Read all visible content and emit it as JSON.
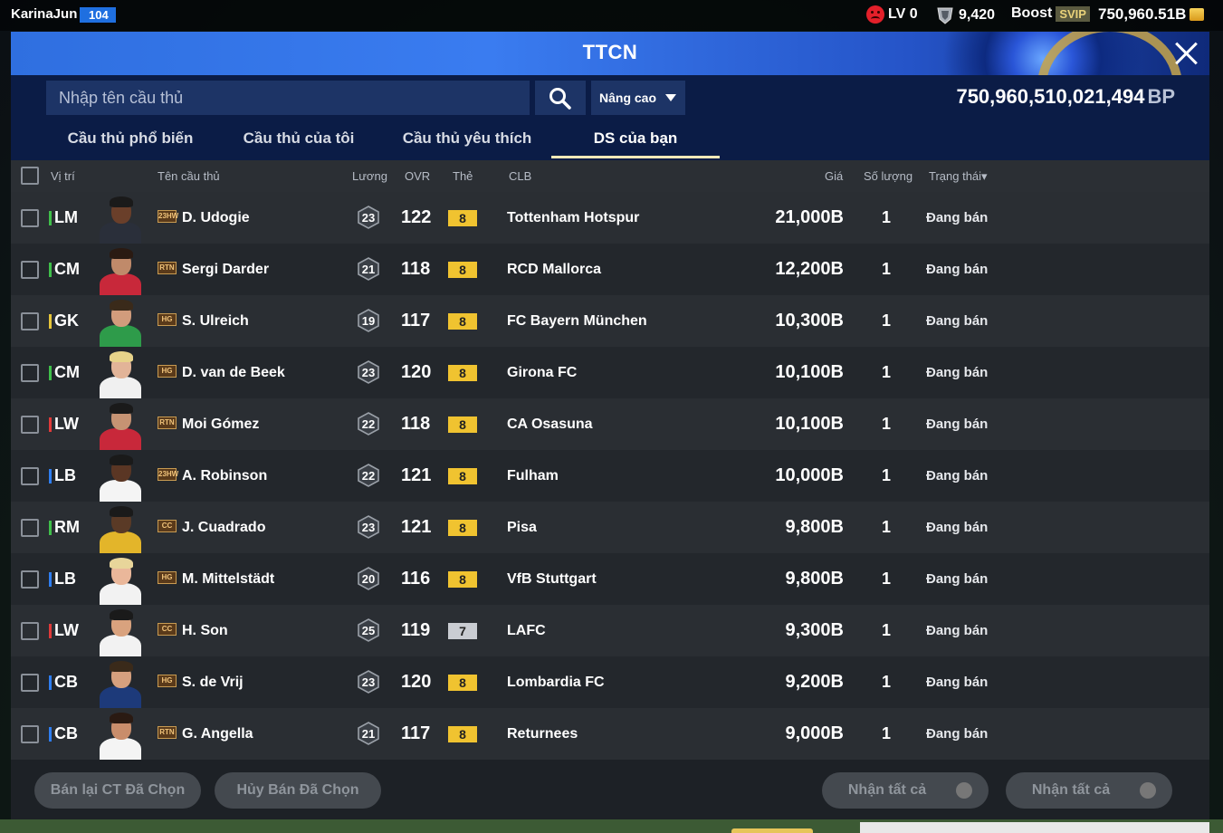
{
  "topbar": {
    "user_name": "KarinaJun",
    "user_level": "104",
    "lv_label": "LV 0",
    "trophy_value": "9,420",
    "boost_label": "Boost",
    "svip_label": "SVIP",
    "coins": "750,960.51B"
  },
  "modal": {
    "title": "TTCN",
    "search_placeholder": "Nhập tên cầu thủ",
    "advanced_label": "Nâng cao",
    "bp_amount": "750,960,510,021,494",
    "bp_unit": "BP"
  },
  "tabs": [
    "Cầu thủ phổ biến",
    "Cầu thủ của tôi",
    "Cầu thủ yêu thích",
    "DS của bạn"
  ],
  "columns": {
    "position": "Vị trí",
    "name": "Tên cầu thủ",
    "salary": "Lương",
    "ovr": "OVR",
    "grade": "Thẻ",
    "club": "CLB",
    "price": "Giá",
    "quantity": "Số lượng",
    "status": "Trạng thái▾"
  },
  "rows": [
    {
      "pos": "LM",
      "name": "D. Udogie",
      "season": "23HW",
      "salary": "23",
      "ovr": "122",
      "grade": "8",
      "club": "Tottenham Hotspur",
      "price": "21,000B",
      "qty": "1",
      "status": "Đang bán"
    },
    {
      "pos": "CM",
      "name": "Sergi Darder",
      "season": "RTN",
      "salary": "21",
      "ovr": "118",
      "grade": "8",
      "club": "RCD Mallorca",
      "price": "12,200B",
      "qty": "1",
      "status": "Đang bán"
    },
    {
      "pos": "GK",
      "name": "S. Ulreich",
      "season": "HG",
      "salary": "19",
      "ovr": "117",
      "grade": "8",
      "club": "FC Bayern München",
      "price": "10,300B",
      "qty": "1",
      "status": "Đang bán"
    },
    {
      "pos": "CM",
      "name": "D. van de Beek",
      "season": "HG",
      "salary": "23",
      "ovr": "120",
      "grade": "8",
      "club": "Girona FC",
      "price": "10,100B",
      "qty": "1",
      "status": "Đang bán"
    },
    {
      "pos": "LW",
      "name": "Moi Gómez",
      "season": "RTN",
      "salary": "22",
      "ovr": "118",
      "grade": "8",
      "club": "CA Osasuna",
      "price": "10,100B",
      "qty": "1",
      "status": "Đang bán"
    },
    {
      "pos": "LB",
      "name": "A. Robinson",
      "season": "23HW",
      "salary": "22",
      "ovr": "121",
      "grade": "8",
      "club": "Fulham",
      "price": "10,000B",
      "qty": "1",
      "status": "Đang bán"
    },
    {
      "pos": "RM",
      "name": "J. Cuadrado",
      "season": "CC",
      "salary": "23",
      "ovr": "121",
      "grade": "8",
      "club": "Pisa",
      "price": "9,800B",
      "qty": "1",
      "status": "Đang bán"
    },
    {
      "pos": "LB",
      "name": "M. Mittelstädt",
      "season": "HG",
      "salary": "20",
      "ovr": "116",
      "grade": "8",
      "club": "VfB Stuttgart",
      "price": "9,800B",
      "qty": "1",
      "status": "Đang bán"
    },
    {
      "pos": "LW",
      "name": "H. Son",
      "season": "CC",
      "salary": "25",
      "ovr": "119",
      "grade": "7",
      "club": "LAFC",
      "price": "9,300B",
      "qty": "1",
      "status": "Đang bán"
    },
    {
      "pos": "CB",
      "name": "S. de Vrij",
      "season": "HG",
      "salary": "23",
      "ovr": "120",
      "grade": "8",
      "club": "Lombardia FC",
      "price": "9,200B",
      "qty": "1",
      "status": "Đang bán"
    },
    {
      "pos": "CB",
      "name": "G. Angella",
      "season": "RTN",
      "salary": "21",
      "ovr": "117",
      "grade": "8",
      "club": "Returnees",
      "price": "9,000B",
      "qty": "1",
      "status": "Đang bán"
    }
  ],
  "buttons": {
    "resell_selected": "Bán lại CT Đã Chọn",
    "cancel_selected": "Hủy Bán Đã Chọn",
    "claim_all_1": "Nhận tất cả",
    "claim_all_2": "Nhận tất cả"
  },
  "colors": {
    "header_blue": "#2f6fe0",
    "pos_green": "#3fbf4a",
    "pos_blue": "#2f7ef0",
    "pos_red": "#e03a3a",
    "pos_yellow": "#e6c53a",
    "grade_gold": "#f0c330",
    "grade_silver": "#c9ccd2"
  }
}
